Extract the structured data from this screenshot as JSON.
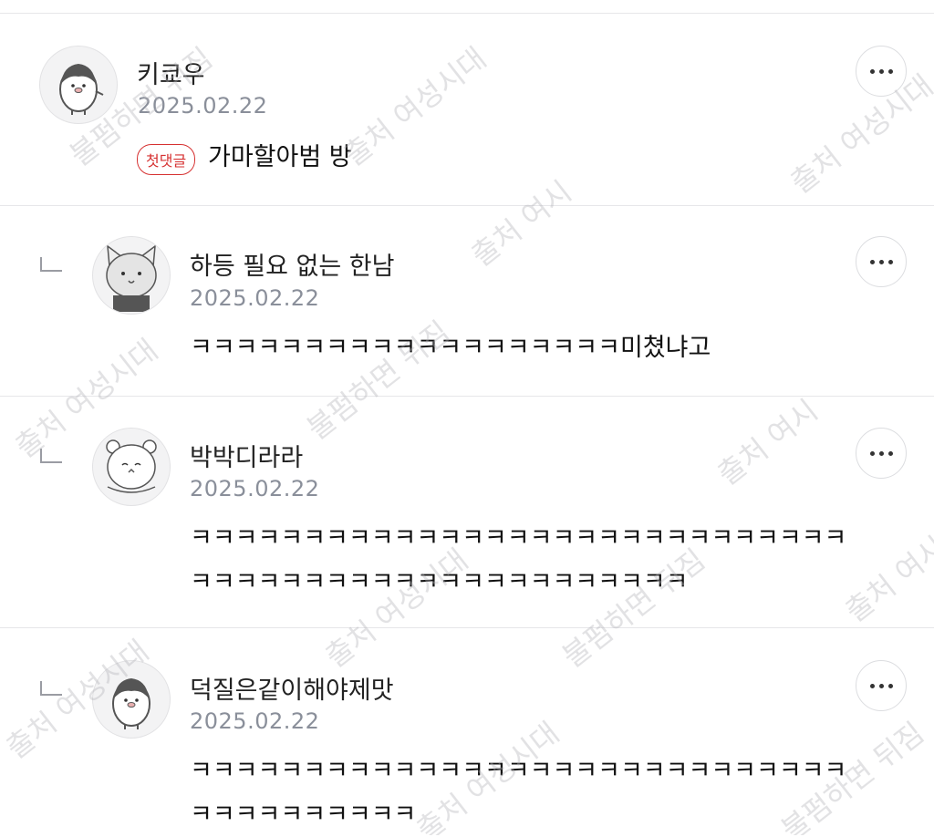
{
  "comments": [
    {
      "author": "키쿄우",
      "date": "2025.02.22",
      "badge": "첫댓글",
      "text": "가마할아범 방",
      "avatar_icon": "penguin-avatar-icon",
      "is_reply": false
    },
    {
      "author": "하등 필요 없는 한남",
      "date": "2025.02.22",
      "text": "ㅋㅋㅋㅋㅋㅋㅋㅋㅋㅋㅋㅋㅋㅋㅋㅋㅋㅋㅋ미쳤냐고",
      "avatar_icon": "cat-avatar-icon",
      "is_reply": true
    },
    {
      "author": "박박디라라",
      "date": "2025.02.22",
      "text": "ㅋㅋㅋㅋㅋㅋㅋㅋㅋㅋㅋㅋㅋㅋㅋㅋㅋㅋㅋㅋㅋㅋㅋㅋㅋㅋㅋㅋㅋ\nㅋㅋㅋㅋㅋㅋㅋㅋㅋㅋㅋㅋㅋㅋㅋㅋㅋㅋㅋㅋㅋㅋ",
      "avatar_icon": "bear-avatar-icon",
      "is_reply": true
    },
    {
      "author": "덕질은같이해야제맛",
      "date": "2025.02.22",
      "text": "ㅋㅋㅋㅋㅋㅋㅋㅋㅋㅋㅋㅋㅋㅋㅋㅋㅋㅋㅋㅋㅋㅋㅋㅋㅋㅋㅋㅋㅋ\nㅋㅋㅋㅋㅋㅋㅋㅋㅋㅋ",
      "avatar_icon": "penguin-avatar-icon",
      "is_reply": true
    }
  ],
  "watermark": {
    "text1": "출처 여성시대",
    "text2": "불펌하면 뒤짐",
    "text3": "출처 여시"
  },
  "colors": {
    "badge": "#d63131",
    "date": "#8a8f9a",
    "divider": "#e6e6e9"
  }
}
